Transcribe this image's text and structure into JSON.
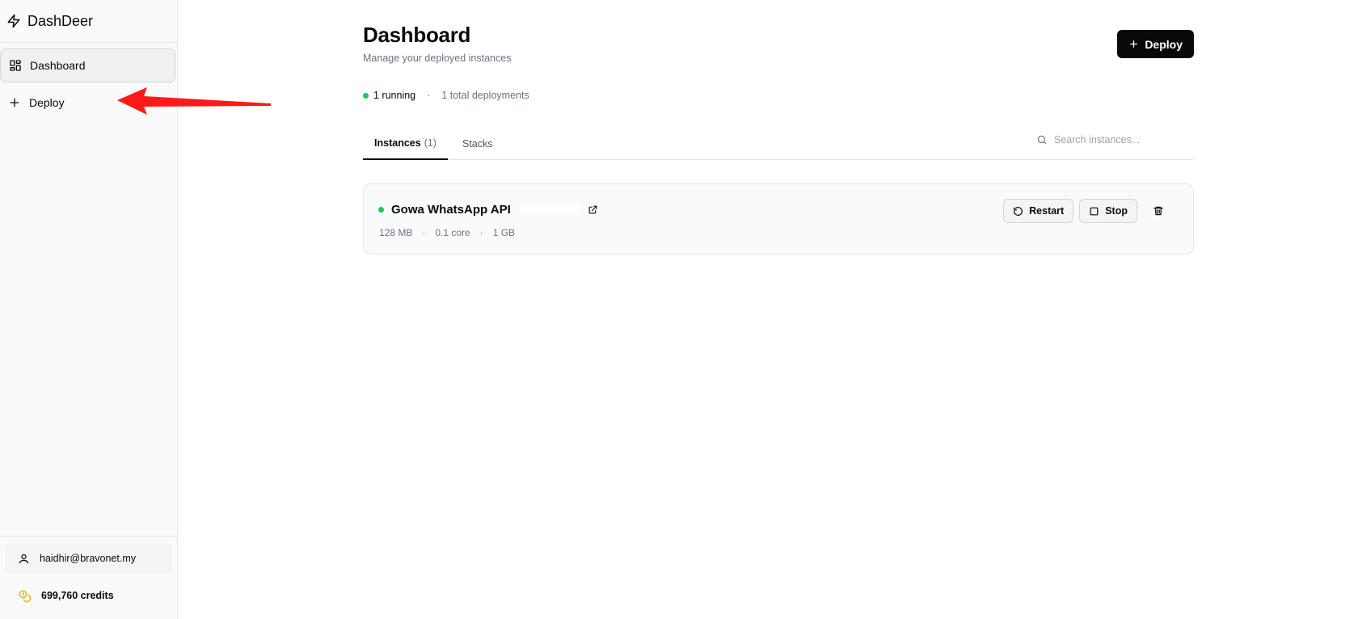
{
  "app": {
    "name": "DashDeer"
  },
  "sidebar": {
    "items": [
      {
        "label": "Dashboard",
        "icon": "layout-grid-icon",
        "active": true
      },
      {
        "label": "Deploy",
        "icon": "plus-icon",
        "active": false
      }
    ],
    "user": {
      "email": "haidhir@bravonet.my",
      "icon": "user-icon"
    },
    "credits": {
      "label": "699,760 credits",
      "icon": "coins-icon",
      "icon_color": "#eab308"
    }
  },
  "header": {
    "title": "Dashboard",
    "subtitle": "Manage your deployed instances",
    "deploy_button": "Deploy"
  },
  "status": {
    "running": "1 running",
    "separator": "·",
    "total": "1 total deployments",
    "dot_color": "#22c55e"
  },
  "tabs": [
    {
      "label": "Instances",
      "count": "(1)",
      "active": true
    },
    {
      "label": "Stacks",
      "count": "",
      "active": false
    }
  ],
  "search": {
    "placeholder": "Search instances..."
  },
  "instances": [
    {
      "name": "Gowa WhatsApp API",
      "status": "running",
      "meta": {
        "memory": "128 MB",
        "cpu": "0.1 core",
        "storage": "1 GB"
      },
      "actions": {
        "restart": "Restart",
        "stop": "Stop"
      }
    }
  ],
  "colors": {
    "accent": "#09090b",
    "annotation_arrow": "#ff1a1a"
  }
}
